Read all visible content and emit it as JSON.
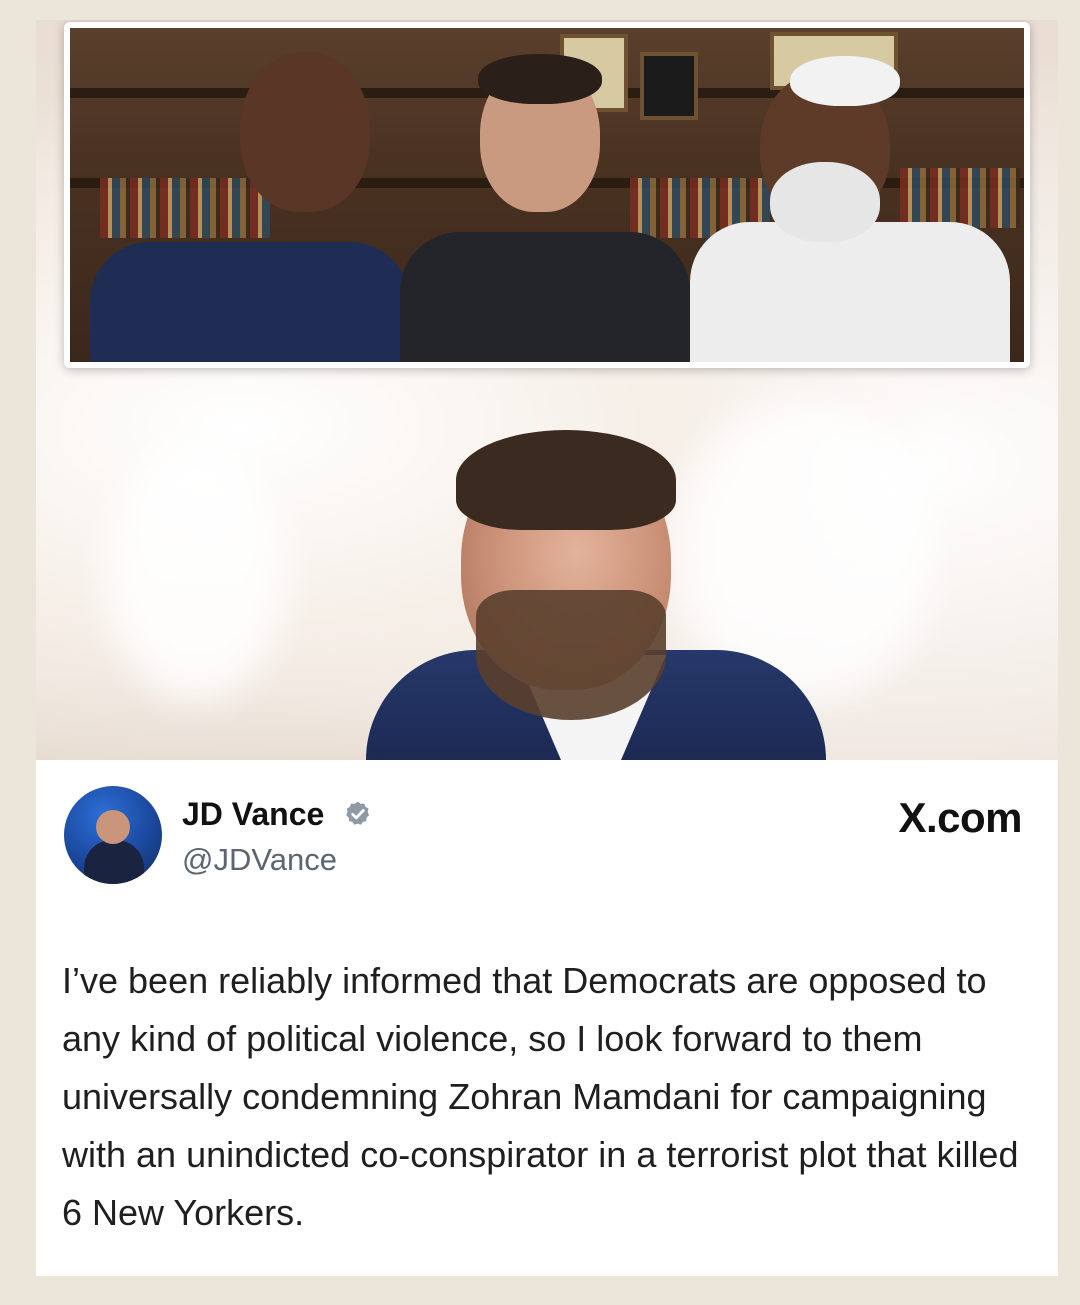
{
  "tweet": {
    "author_name": "JD Vance",
    "author_handle": "@JDVance",
    "site_label": "X.com",
    "text": "I’ve been reliably informed that Democrats are opposed to any kind of political violence, so I look forward to them universally condemning Zohran Mamdani for campaigning with an unindicted co-conspirator in a terrorist plot that killed 6 New Yorkers."
  },
  "icons": {
    "verified": "verified-badge-icon"
  },
  "colors": {
    "page_background": "#ebe6d9",
    "card_background": "#ffffff",
    "text_primary": "#111111",
    "text_secondary": "#5b6670",
    "verified_badge": "#8f9aa6"
  }
}
